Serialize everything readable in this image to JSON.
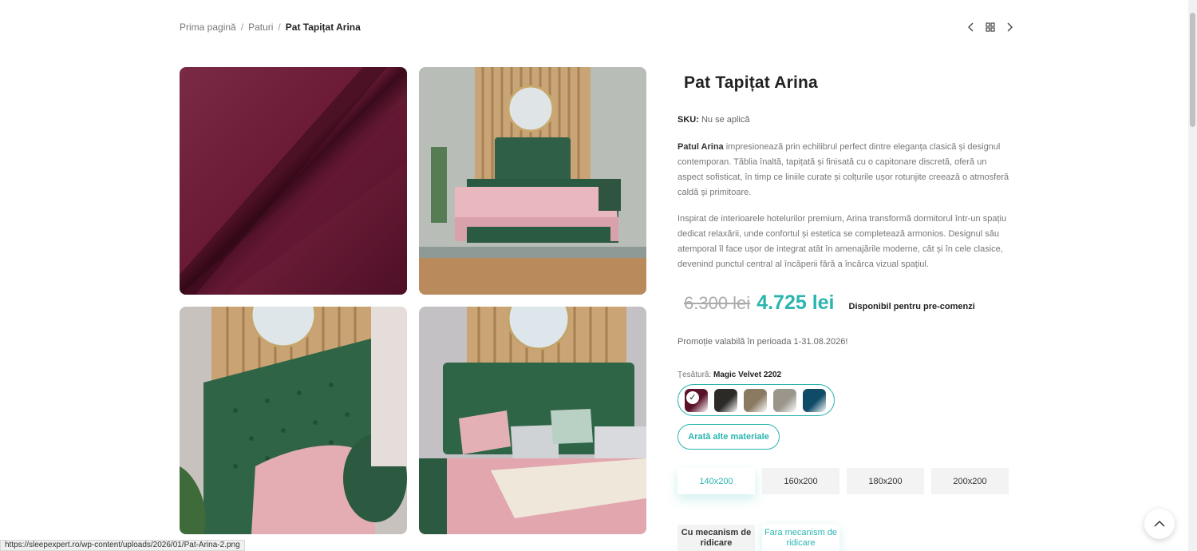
{
  "breadcrumb": {
    "home": "Prima pagină",
    "sep1": "/",
    "category": "Paturi",
    "sep2": "/",
    "current": "Pat Tapițat Arina"
  },
  "product_nav": {
    "prev_icon": "chevron-left-icon",
    "grid_icon": "grid-icon",
    "next_icon": "chevron-right-icon"
  },
  "product": {
    "title": "Pat Tapițat Arina",
    "sku_label": "SKU:",
    "sku_value": "Nu se aplică",
    "desc1_bold": "Patul Arina",
    "desc1_rest": "impresionează prin echilibrul perfect dintre eleganța clasică și designul contemporan. Tăblia înaltă, tapițată și finisată cu o capitonare discretă, oferă un aspect sofisticat, în timp ce liniile curate și colțurile ușor rotunjite creează o atmosferă caldă și primitoare.",
    "desc2": "Inspirat de interioarele hotelurilor premium, Arina transformă dormitorul într-un spațiu dedicat relaxării, unde confortul și estetica se completează armonios. Designul său atemporal îl face ușor de integrat atât în amenajările moderne, cât și în cele clasice, devenind punctul central al încăperii fără a încărca vizual spațiul.",
    "old_price": "6.300 lei",
    "new_price": "4.725 lei",
    "availability": "Disponibil pentru pre-comenzi",
    "promo": "Promoție valabilă în perioada 1-31.08.2026!"
  },
  "fabric": {
    "label": "Țesătură:",
    "selected": "Magic Velvet 2202",
    "swatches": [
      {
        "color": "#5a1228",
        "selected": true
      },
      {
        "color": "#2b2a26"
      },
      {
        "color": "#8a7a62"
      },
      {
        "color": "#9a968c"
      },
      {
        "color": "#0f4a66"
      }
    ],
    "more_button": "Arată alte materiale"
  },
  "sizes": [
    {
      "label": "140x200",
      "active": true
    },
    {
      "label": "160x200"
    },
    {
      "label": "180x200"
    },
    {
      "label": "200x200"
    }
  ],
  "mechanism": [
    {
      "label": "Cu mecanism de ridicare",
      "active": false
    },
    {
      "label": "Fara mecanism de ridicare",
      "active": true
    }
  ],
  "status_url": "https://sleepexpert.ro/wp-content/uploads/2026/01/Pat-Arina-2.png",
  "colors": {
    "accent": "#2bb5b0"
  }
}
